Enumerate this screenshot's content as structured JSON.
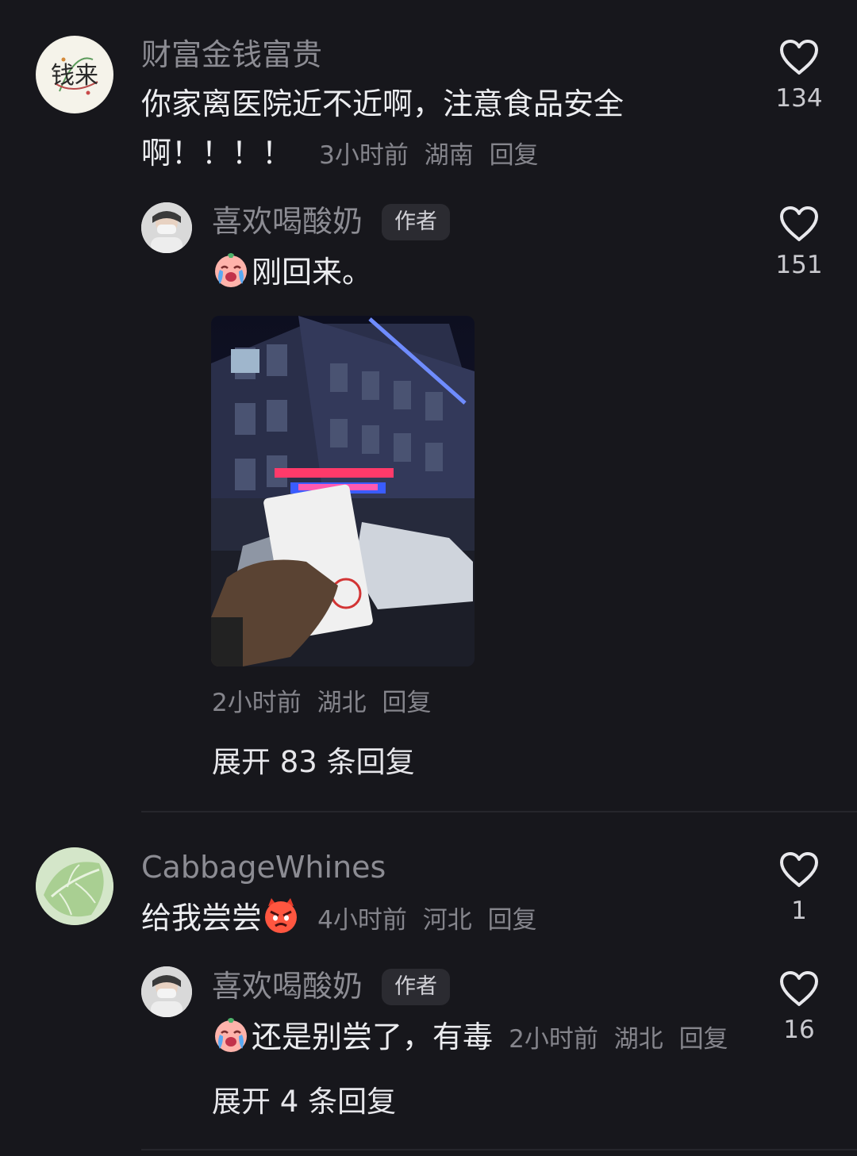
{
  "comments": [
    {
      "username": "财富金钱富贵",
      "text_line1": "你家离医院近不近啊，注意食品安全",
      "text_line2": "啊！！！！",
      "time": "3小时前",
      "location": "湖南",
      "reply_label": "回复",
      "like_count": "134",
      "avatar_text": "钱来",
      "avatar_icon": "calligraphy-avatar-icon"
    },
    {
      "username": "CabbageWhines",
      "text": "给我尝尝",
      "time": "4小时前",
      "location": "河北",
      "reply_label": "回复",
      "like_count": "1",
      "avatar_icon": "cabbage-avatar-icon"
    }
  ],
  "replies": [
    {
      "username": "喜欢喝酸奶",
      "badge": "作者",
      "text": "刚回来。",
      "time": "2小时前",
      "location": "湖北",
      "reply_label": "回复",
      "like_count": "151",
      "expand_label": "展开 83 条回复",
      "photo_icon": "hospital-night-photo"
    },
    {
      "username": "喜欢喝酸奶",
      "badge": "作者",
      "text": "还是别尝了，有毒",
      "time": "2小时前",
      "location": "湖北",
      "reply_label": "回复",
      "like_count": "16",
      "expand_label": "展开 4 条回复"
    }
  ],
  "colors": {
    "background": "#17171c",
    "username": "#8c8c93",
    "text": "#ecedf0",
    "meta": "#85858c"
  }
}
